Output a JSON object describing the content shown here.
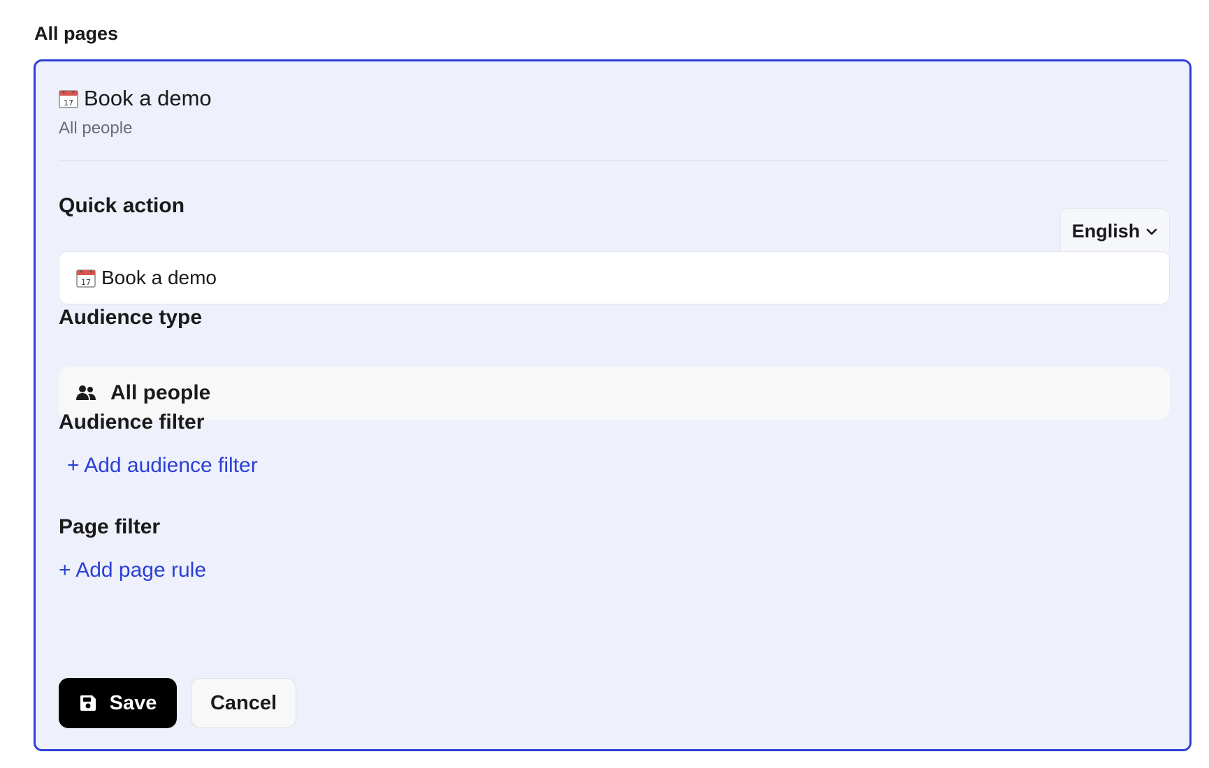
{
  "page": {
    "section_title": "All pages"
  },
  "card": {
    "title": "Book a demo",
    "subtitle": "All people",
    "title_icon": "calendar-icon"
  },
  "quick_action": {
    "label": "Quick action",
    "language": "English",
    "value": "Book a demo",
    "value_icon": "calendar-icon"
  },
  "audience_type": {
    "label": "Audience type",
    "value": "All people",
    "icon": "people-icon"
  },
  "audience_filter": {
    "label": "Audience filter",
    "add_link": "+ Add audience filter"
  },
  "page_filter": {
    "label": "Page filter",
    "add_link": "+ Add page rule"
  },
  "actions": {
    "save_label": "Save",
    "save_icon": "save-icon",
    "cancel_label": "Cancel"
  },
  "colors": {
    "accent": "#2b3fd6",
    "card_background": "#eef0fb",
    "primary_button": "#000000"
  }
}
